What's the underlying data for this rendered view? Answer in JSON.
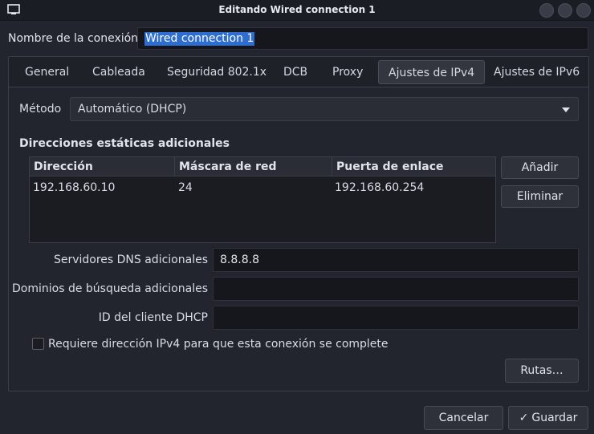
{
  "window": {
    "title": "Editando Wired connection 1"
  },
  "connection": {
    "name_label": "Nombre de la conexión",
    "name_value": "Wired connection 1"
  },
  "tabs": [
    {
      "label": "General"
    },
    {
      "label": "Cableada"
    },
    {
      "label": "Seguridad 802.1x"
    },
    {
      "label": "DCB"
    },
    {
      "label": "Proxy"
    },
    {
      "label": "Ajustes de IPv4"
    },
    {
      "label": "Ajustes de IPv6"
    }
  ],
  "active_tab": "Ajustes de IPv4",
  "ipv4": {
    "method_label": "Método",
    "method_value": "Automático (DHCP)",
    "static_title": "Direcciones estáticas adicionales",
    "table": {
      "columns": [
        "Dirección",
        "Máscara de red",
        "Puerta de enlace"
      ],
      "rows": [
        [
          "192.168.60.10",
          "24",
          "192.168.60.254"
        ]
      ]
    },
    "add_label": "Añadir",
    "remove_label": "Eliminar",
    "dns_label": "Servidores DNS adicionales",
    "dns_value": "8.8.8.8",
    "search_label": "Dominios de búsqueda adicionales",
    "search_value": "",
    "dhcp_id_label": "ID del cliente DHCP",
    "dhcp_id_value": "",
    "require_label": "Requiere dirección IPv4 para que esta conexión se complete",
    "require_checked": false,
    "routes_label": "Rutas…"
  },
  "footer": {
    "cancel_label": "Cancelar",
    "save_label": "Guardar",
    "save_glyph": "✓"
  },
  "colors": {
    "accent": "#2d6ed0",
    "background": "#23252e"
  }
}
